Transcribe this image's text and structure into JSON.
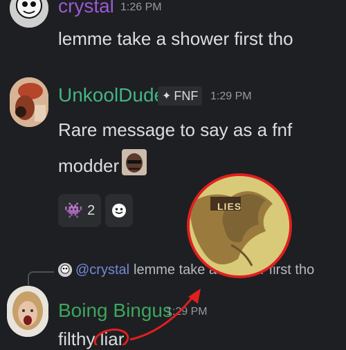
{
  "messages": [
    {
      "author": "crystal",
      "author_color": "#9b59d6",
      "time": "1:26 PM",
      "text": "lemme take a shower first tho"
    },
    {
      "author": "UnkoolDude",
      "author_color": "#43b581",
      "tag": "FNF",
      "time": "1:29 PM",
      "text_line1": "Rare message to say as a fnf",
      "text_line2": "modder",
      "reactions": [
        {
          "icon": "invader-icon",
          "count": "2"
        },
        {
          "icon": "ghost-face-icon",
          "count": ""
        }
      ]
    },
    {
      "reply_to_author": "@crystal",
      "reply_text": "lemme take a shower first tho",
      "author": "Boing Bingus",
      "author_color": "#3ba55d",
      "time": "1:29 PM",
      "text": "filthy liar"
    }
  ],
  "overlay": {
    "zoom_label": "LIES",
    "accent": "#e01f1f"
  },
  "colors": {
    "background": "#1e1f22",
    "text": "#dbdee1",
    "muted": "#949ba4",
    "mention": "#7289da"
  }
}
